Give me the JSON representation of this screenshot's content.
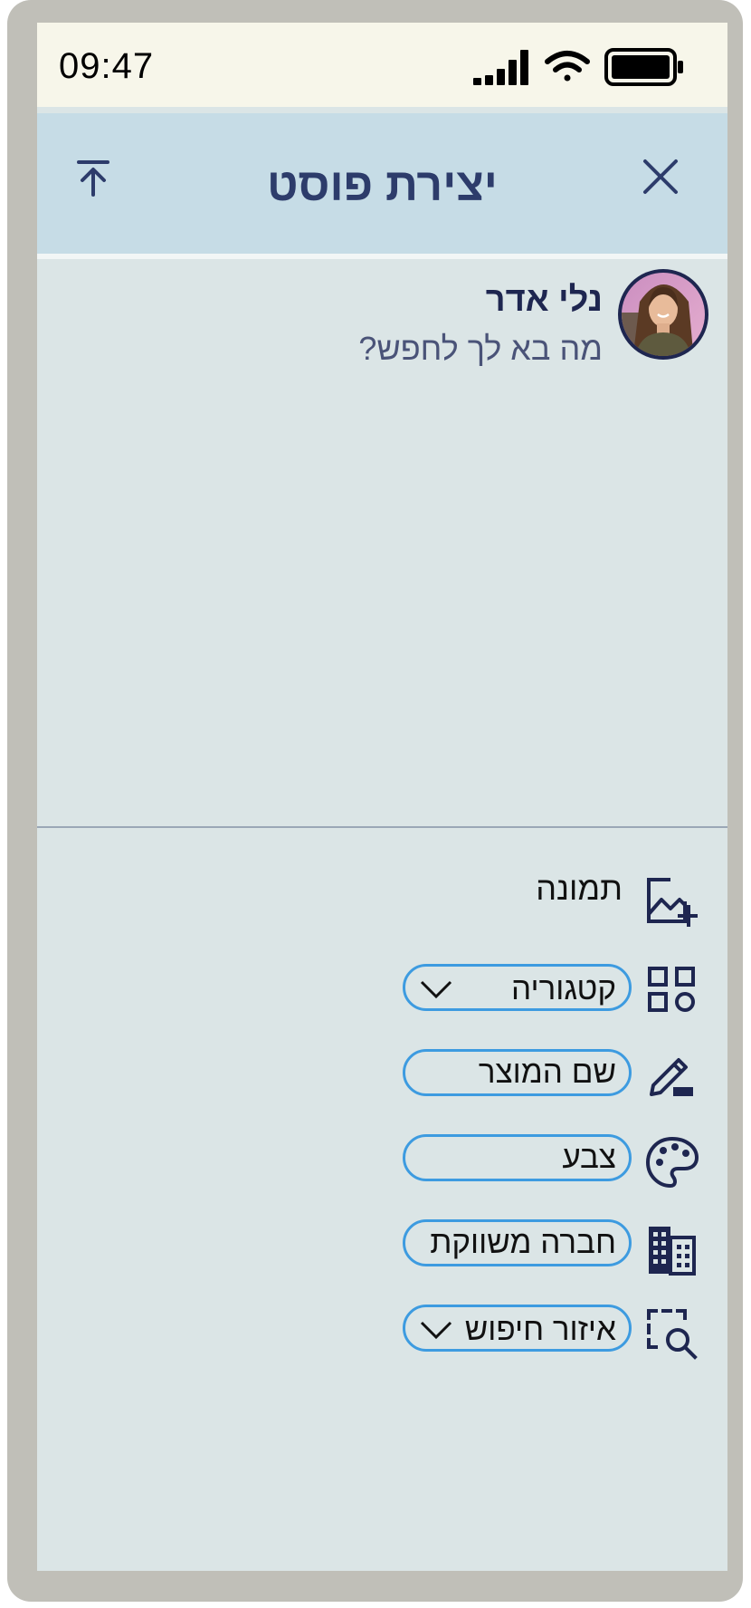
{
  "status_bar": {
    "time": "09:47"
  },
  "header": {
    "title": "יצירת פוסט"
  },
  "post": {
    "user_name": "נלי אדר",
    "placeholder": "מה בא לך לחפש?"
  },
  "attributes": {
    "photo_label": "תמונה",
    "category_label": "קטגוריה",
    "product_name_placeholder": "שם המוצר",
    "color_placeholder": "צבע",
    "company_placeholder": "חברה משווקת",
    "search_area_label": "איזור חיפוש"
  },
  "colors": {
    "accent": "#3d9be0",
    "icon_navy": "#1e2650",
    "header_bg": "#c6dce6",
    "screen_bg": "#dbe5e6"
  }
}
